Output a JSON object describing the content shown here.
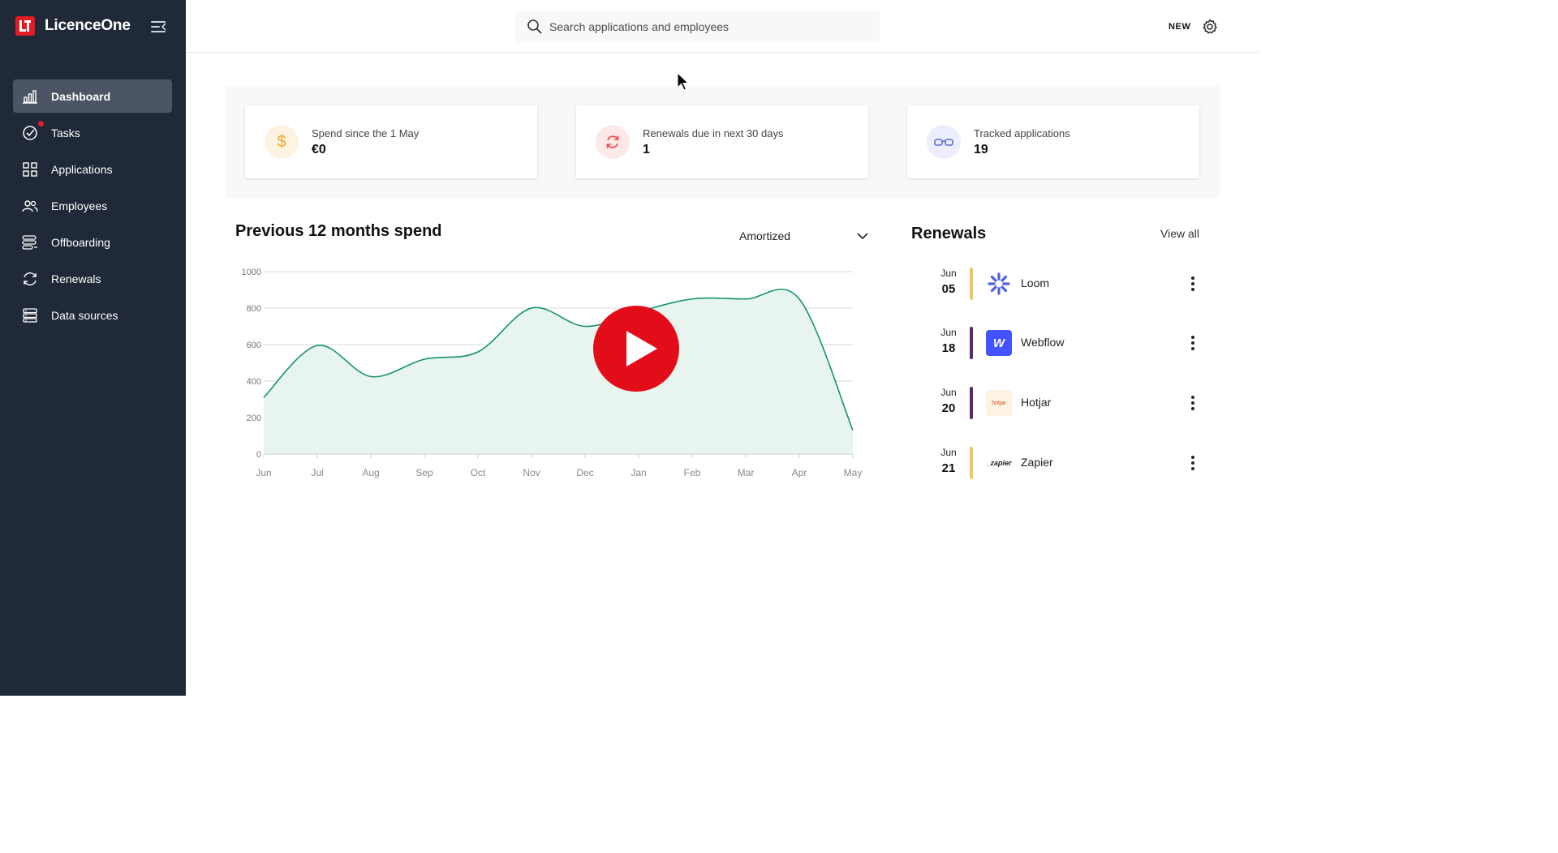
{
  "app": {
    "brand": "LicenceOne"
  },
  "sidebar": {
    "items": [
      {
        "label": "Dashboard",
        "icon": "bar-chart-icon",
        "active": true
      },
      {
        "label": "Tasks",
        "icon": "check-circle-icon",
        "badge": true
      },
      {
        "label": "Applications",
        "icon": "grid-icon"
      },
      {
        "label": "Employees",
        "icon": "users-icon"
      },
      {
        "label": "Offboarding",
        "icon": "offboarding-icon"
      },
      {
        "label": "Renewals",
        "icon": "refresh-icon"
      },
      {
        "label": "Data sources",
        "icon": "database-icon"
      }
    ]
  },
  "header": {
    "search_placeholder": "Search applications and employees",
    "new_label": "NEW"
  },
  "stats": [
    {
      "label": "Spend since the 1 May",
      "value": "€0",
      "icon": "dollar-icon",
      "color": "#f59e0b"
    },
    {
      "label": "Renewals due in next 30 days",
      "value": "1",
      "icon": "refresh-icon",
      "color": "#ef4444"
    },
    {
      "label": "Tracked applications",
      "value": "19",
      "icon": "glasses-icon",
      "color": "#6366f1"
    }
  ],
  "spend": {
    "title": "Previous 12 months spend",
    "mode": "Amortized"
  },
  "chart_data": {
    "type": "area",
    "categories": [
      "Jun",
      "Jul",
      "Aug",
      "Sep",
      "Oct",
      "Nov",
      "Dec",
      "Jan",
      "Feb",
      "Mar",
      "Apr",
      "May"
    ],
    "values": [
      310,
      595,
      425,
      520,
      560,
      800,
      700,
      780,
      850,
      850,
      850,
      130
    ],
    "yticks": [
      0,
      200,
      400,
      600,
      800,
      1000
    ],
    "ylim": [
      0,
      1000
    ],
    "grid": true,
    "line_color": "#16926a",
    "fill_color": "#e8f5ef"
  },
  "renewals": {
    "title": "Renewals",
    "view_all": "View all",
    "items": [
      {
        "month": "Jun",
        "day": "05",
        "name": "Loom",
        "bar_color": "#f6c568"
      },
      {
        "month": "Jun",
        "day": "18",
        "name": "Webflow",
        "bar_color": "#5b2a6e"
      },
      {
        "month": "Jun",
        "day": "20",
        "name": "Hotjar",
        "bar_color": "#5b2a6e"
      },
      {
        "month": "Jun",
        "day": "21",
        "name": "Zapier",
        "bar_color": "#f6c568"
      }
    ],
    "logo_text": {
      "hotjar": "hotjar",
      "zapier": "zapier",
      "webflow": "W"
    }
  }
}
